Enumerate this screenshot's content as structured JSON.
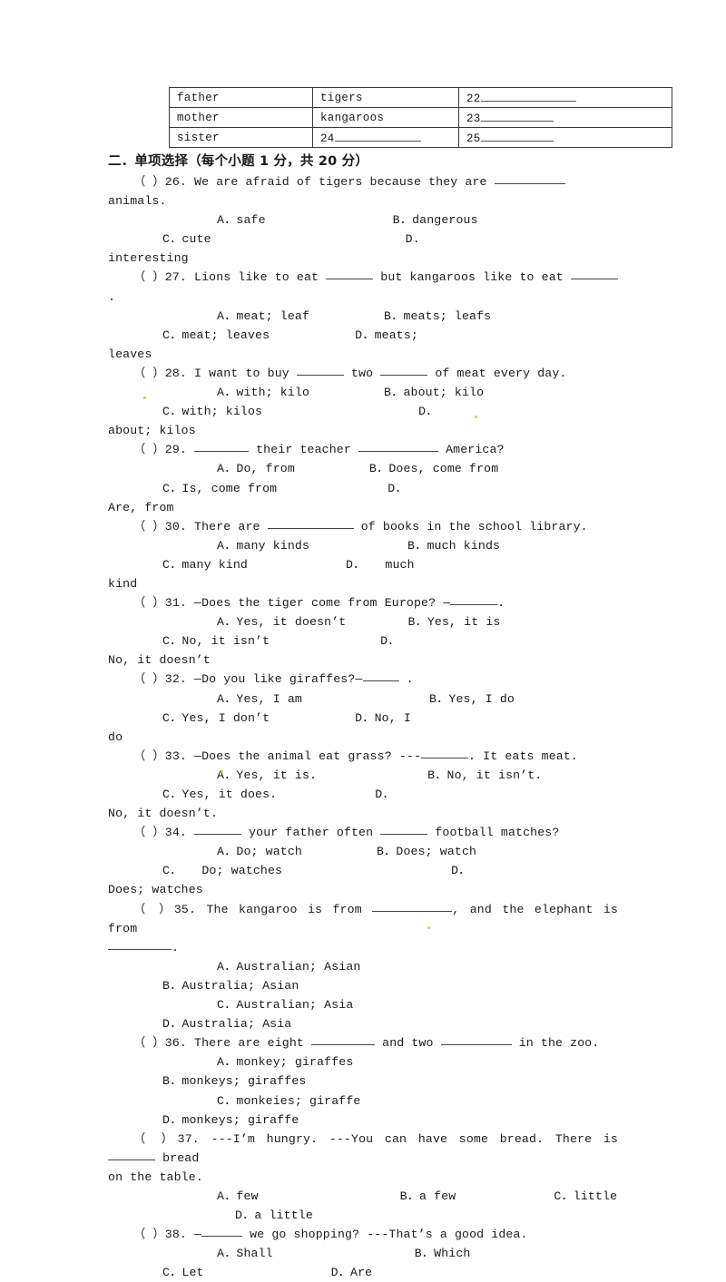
{
  "table": {
    "rows": [
      {
        "person": "father",
        "animal": "tigers",
        "num": "22",
        "blank_after_animal": false
      },
      {
        "person": "mother",
        "animal": "kangaroos",
        "num": "23",
        "blank_after_animal": false
      },
      {
        "person": "sister",
        "animal": "24",
        "num": "25",
        "blank_after_animal": true
      }
    ]
  },
  "section": {
    "title": "二．单项选择（每个小题 1 分，共 20 分）"
  },
  "questions": [
    {
      "marker": "（  ）",
      "number": "26.",
      "stem_a": "We are afraid of tigers because they are ",
      "stem_b": " animals.",
      "options_line": "A．safe          B．dangerous          C．cute                    D.",
      "options_wrap": "interesting",
      "opts": [
        {
          "letter": "A．",
          "text": "safe"
        },
        {
          "letter": "B．",
          "text": "dangerous"
        },
        {
          "letter": "C．",
          "text": "cute"
        },
        {
          "letter": "D.",
          "text": "interesting"
        }
      ]
    },
    {
      "marker": "（  ）",
      "number": "27.",
      "stem_a": "Lions like to eat ",
      "stem_b": " but kangaroos like to eat ",
      "stem_c": ".",
      "opts": [
        {
          "letter": "A．",
          "text": "meat; leaf"
        },
        {
          "letter": "B．",
          "text": "meats; leafs"
        },
        {
          "letter": "C．",
          "text": "meat; leaves"
        },
        {
          "letter": "D．",
          "text": "meats; leaves"
        }
      ],
      "options_wrap": "leaves"
    },
    {
      "marker": "（  ）",
      "number": "28.",
      "stem_a": "I want to buy ",
      "stem_b": " two ",
      "stem_c": " of meat every day.",
      "opts": [
        {
          "letter": "A．",
          "text": "with; kilo"
        },
        {
          "letter": "B．",
          "text": "about; kilo"
        },
        {
          "letter": "C．",
          "text": "with; kilos"
        },
        {
          "letter": "D．",
          "text": "about; kilos"
        }
      ],
      "options_wrap": "about; kilos"
    },
    {
      "marker": "（  ）",
      "number": "29.",
      "stem_a": "",
      "stem_b": " their teacher ",
      "stem_c": " America?",
      "opts": [
        {
          "letter": "A．",
          "text": "Do, from"
        },
        {
          "letter": "B．",
          "text": "Does, come from"
        },
        {
          "letter": "C．",
          "text": "Is, come from"
        },
        {
          "letter": "D．",
          "text": "Are, from"
        }
      ],
      "options_wrap": "Are, from"
    },
    {
      "marker": "（  ）",
      "number": "30.",
      "stem_a": "There are ",
      "stem_b": " of books in the school library.",
      "opts": [
        {
          "letter": "A．",
          "text": "many kinds"
        },
        {
          "letter": "B．",
          "text": "much kinds"
        },
        {
          "letter": "C．",
          "text": "many kind"
        },
        {
          "letter": "D．",
          "text": "much kind"
        }
      ],
      "options_wrap": "kind"
    },
    {
      "marker": "（  ）",
      "number": "31.",
      "stem_a": "—Does the tiger come from Europe? —",
      "stem_b": ".",
      "opts": [
        {
          "letter": "A．",
          "text": "Yes, it doesn’t"
        },
        {
          "letter": "B．",
          "text": "Yes, it is"
        },
        {
          "letter": "C．",
          "text": "No, it isn’t"
        },
        {
          "letter": "D．",
          "text": "No, it doesn’t"
        }
      ],
      "options_wrap": "No, it doesn’t"
    },
    {
      "marker": "（  ）",
      "number": "32.",
      "stem_a": "—Do you like giraffes?—",
      "stem_b": " .",
      "opts": [
        {
          "letter": "A．",
          "text": "Yes, I am"
        },
        {
          "letter": "B．",
          "text": "Yes, I do"
        },
        {
          "letter": "C．",
          "text": "Yes, I don’t"
        },
        {
          "letter": "D．",
          "text": "No, I do"
        }
      ],
      "options_wrap": "do"
    },
    {
      "marker": "（  ）",
      "number": "33.",
      "stem_a": "—Does the animal eat grass? ---",
      "stem_b": ". It eats meat.",
      "opts": [
        {
          "letter": "A．",
          "text": "Yes, it is."
        },
        {
          "letter": "B．",
          "text": "No, it isn’t."
        },
        {
          "letter": "C．",
          "text": "Yes, it does."
        },
        {
          "letter": "D．",
          "text": "No, it doesn’t."
        }
      ],
      "options_wrap": "No, it doesn’t."
    },
    {
      "marker": "（  ）",
      "number": "34.",
      "stem_a": "",
      "stem_b": " your father often ",
      "stem_c": " football matches?",
      "opts": [
        {
          "letter": "A．",
          "text": "Do; watch"
        },
        {
          "letter": "B．",
          "text": "Does; watch"
        },
        {
          "letter": "C．",
          "text": "Do; watches"
        },
        {
          "letter": "D．",
          "text": "Does; watches"
        }
      ],
      "options_wrap": "Does; watches"
    },
    {
      "marker": "（  ）",
      "number": "35.",
      "stem_a": "The kangaroo is from ",
      "stem_b": ", and the elephant is from ",
      "stem_c": ".",
      "opts": [
        {
          "letter": "A．",
          "text": "Australian; Asian"
        },
        {
          "letter": "B．",
          "text": "Australia; Asian"
        },
        {
          "letter": "C．",
          "text": "Australian; Asia"
        },
        {
          "letter": "D．",
          "text": "Australia; Asia"
        }
      ]
    },
    {
      "marker": "（  ）",
      "number": "36.",
      "stem_a": "There are eight ",
      "stem_b": " and two ",
      "stem_c": " in the zoo.",
      "opts": [
        {
          "letter": "A．",
          "text": "monkey; giraffes"
        },
        {
          "letter": "B．",
          "text": "monkeys; giraffes"
        },
        {
          "letter": "C．",
          "text": "monkeies; giraffe"
        },
        {
          "letter": "D．",
          "text": "monkeys; giraffe"
        }
      ]
    },
    {
      "marker": "（  ）",
      "number": "37.",
      "stem_a": "---I’m hungry. ---You can have some bread. There is ",
      "stem_b": " bread",
      "stem_wrap": "on the table.",
      "opts": [
        {
          "letter": "A．",
          "text": "few"
        },
        {
          "letter": "B．",
          "text": "a few"
        },
        {
          "letter": "C．",
          "text": "little"
        },
        {
          "letter": "D．",
          "text": "a little"
        }
      ]
    },
    {
      "marker": "（  ）",
      "number": "38.",
      "stem_a": "—",
      "stem_b": " we go shopping? ---That’s a good idea.",
      "opts": [
        {
          "letter": "A．",
          "text": "Shall"
        },
        {
          "letter": "B．",
          "text": "Which"
        },
        {
          "letter": "C．",
          "text": "Let"
        },
        {
          "letter": "D．",
          "text": "Are"
        }
      ]
    }
  ]
}
